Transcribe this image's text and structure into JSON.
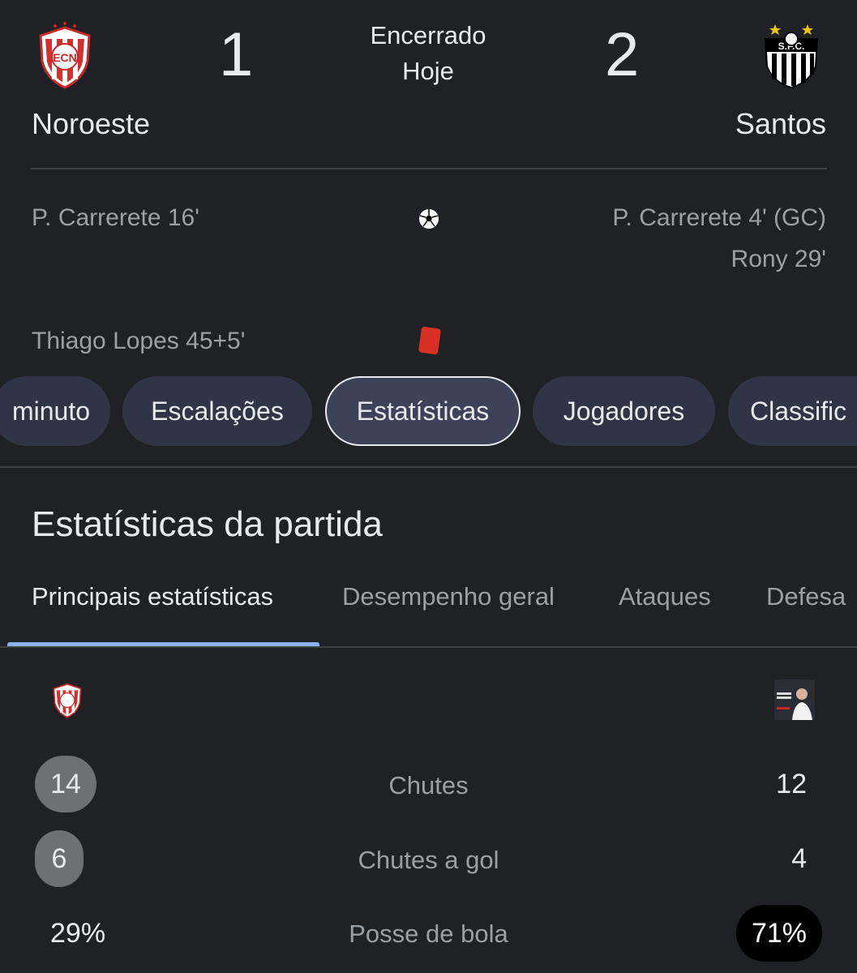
{
  "match": {
    "home": {
      "name": "Noroeste",
      "score": "1",
      "logo_text": "ECN"
    },
    "away": {
      "name": "Santos",
      "score": "2",
      "logo_text": "S.F.C."
    },
    "status_line1": "Encerrado",
    "status_line2": "Hoje"
  },
  "events": {
    "goals_home": [
      "P. Carrerete 16'"
    ],
    "goals_away": [
      "P. Carrerete 4' (GC)",
      "Rony 29'"
    ],
    "cards_home": [
      "Thiago Lopes 45+5'"
    ],
    "goal_icon": "soccer-ball-icon",
    "card_icon": "red-card-icon"
  },
  "chips": [
    {
      "label": "minuto"
    },
    {
      "label": "Escalações"
    },
    {
      "label": "Estatísticas"
    },
    {
      "label": "Jogadores"
    },
    {
      "label": "Classific"
    }
  ],
  "stats": {
    "title": "Estatísticas da partida",
    "tabs": [
      "Principais estatísticas",
      "Desempenho geral",
      "Ataques",
      "Defesa"
    ],
    "rows": [
      {
        "label": "Chutes",
        "home": "14",
        "away": "12"
      },
      {
        "label": "Chutes a gol",
        "home": "6",
        "away": "4"
      },
      {
        "label": "Posse de bola",
        "home": "29%",
        "away": "71%"
      }
    ]
  },
  "colors": {
    "background": "#202124",
    "chip_bg": "#303545",
    "tab_indicator": "#8ab4f8",
    "red_card": "#d93025"
  }
}
